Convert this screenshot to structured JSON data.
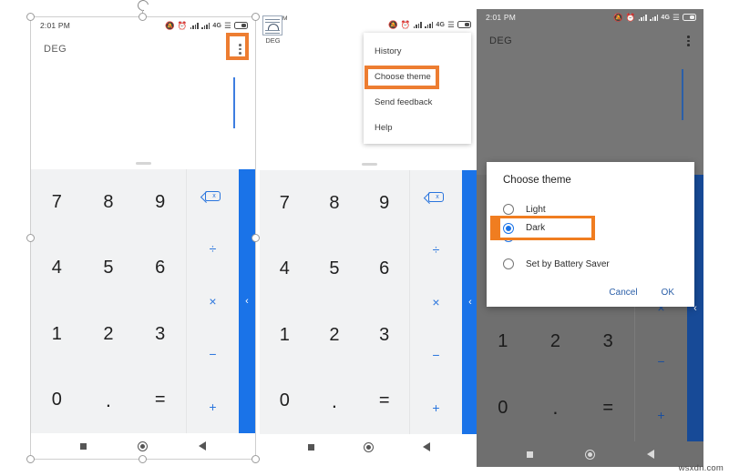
{
  "meta": {
    "watermark": "wsxdn.com"
  },
  "colors": {
    "accent_blue": "#1a73e8",
    "operator_blue": "#2a75dd",
    "highlight_orange": "#ed7d31",
    "dialog_highlight_orange": "#f07d20",
    "keypad_light": "#f1f2f3",
    "dim_overlay_grey": "#767676",
    "link_blue": "#2b5fa8"
  },
  "statusbar": {
    "time": "2:01 PM",
    "network_label": "4G",
    "icons": [
      "bell-off-icon",
      "alarm-icon",
      "signal-bars-icon",
      "signal-bars-icon",
      "network-4g-label",
      "vibrate-icon",
      "battery-icon"
    ]
  },
  "appbar": {
    "mode_label": "DEG",
    "overflow_icon": "kebab-menu-icon"
  },
  "keypad": {
    "numbers": [
      "7",
      "8",
      "9",
      "4",
      "5",
      "6",
      "1",
      "2",
      "3",
      "0",
      ".",
      "="
    ],
    "operators": [
      "delete",
      "÷",
      "×",
      "−",
      "+"
    ],
    "delete_glyph": "x",
    "expand_chevron": "‹"
  },
  "navbar": {
    "items": [
      "recents-square-icon",
      "home-circle-icon",
      "back-triangle-icon"
    ]
  },
  "overflow_menu": {
    "items": [
      {
        "label": "History",
        "selected": false
      },
      {
        "label": "Choose theme",
        "selected": true
      },
      {
        "label": "Send feedback",
        "selected": false
      },
      {
        "label": "Help",
        "selected": false
      }
    ]
  },
  "theme_dialog": {
    "title": "Choose theme",
    "options": [
      {
        "label": "Light",
        "checked": false,
        "highlighted": false
      },
      {
        "label": "Dark",
        "checked": true,
        "highlighted": true
      },
      {
        "label": "Set by Battery Saver",
        "checked": false,
        "highlighted": false
      }
    ],
    "cancel_label": "Cancel",
    "ok_label": "OK"
  },
  "thumbnail_fragment": {
    "badge": "M",
    "caption": "DEG"
  }
}
